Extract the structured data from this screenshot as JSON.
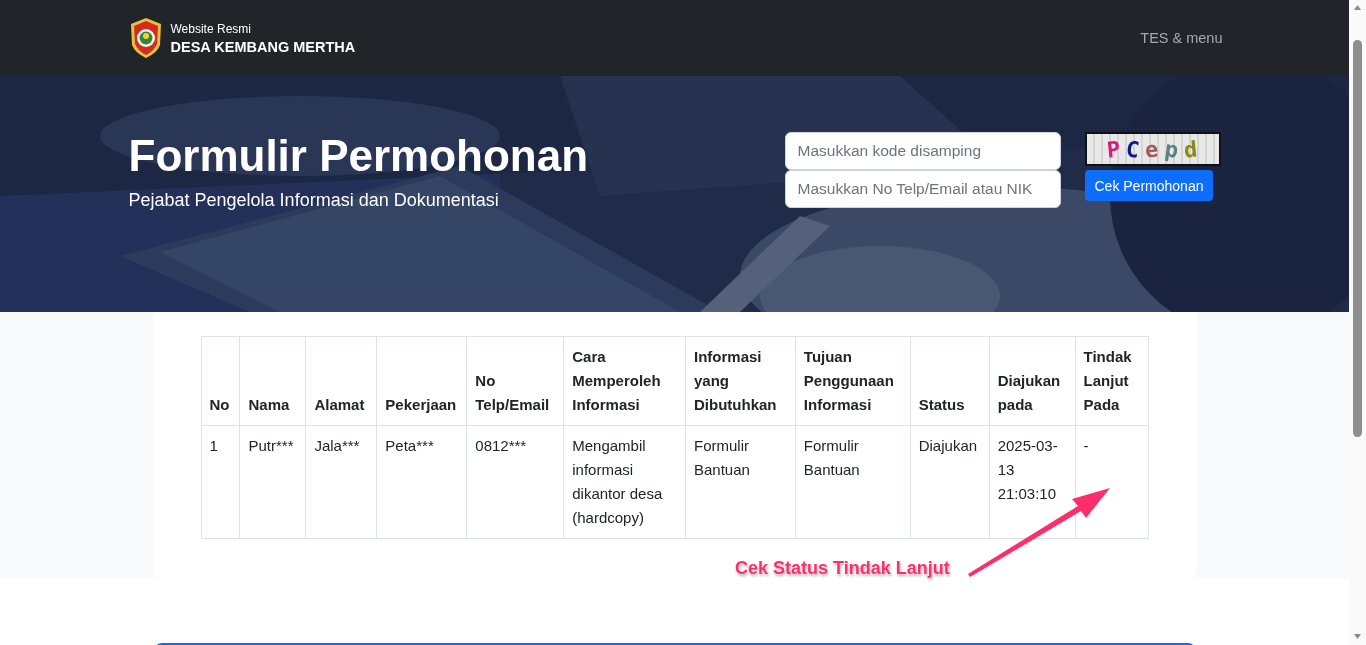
{
  "navbar": {
    "subtitle": "Website Resmi",
    "title": "DESA KEMBANG MERTHA",
    "menu": "TES & menu"
  },
  "hero": {
    "title": "Formulir Permohonan",
    "subtitle": "Pejabat Pengelola Informasi dan Dokumentasi",
    "code_field": {
      "placeholder": "Masukkan kode disamping"
    },
    "id_field": {
      "placeholder": "Masukkan No Telp/Email atau NIK"
    },
    "captcha": "PCepd",
    "button": "Cek Permohonan"
  },
  "table": {
    "columns": [
      "No",
      "Nama",
      "Alamat",
      "Pekerjaan",
      "No Telp/Email",
      "Cara Memperoleh Informasi",
      "Informasi yang Dibutuhkan",
      "Tujuan Penggunaan Informasi",
      "Status",
      "Diajukan pada",
      "Tindak Lanjut Pada"
    ],
    "rows": [
      [
        "1",
        "Putr***",
        "Jala***",
        "Peta***",
        "0812***",
        "Mengambil informasi dikantor desa (hardcopy)",
        "Formulir Bantuan",
        "Formulir Bantuan",
        "Diajukan",
        "2025-03-13 21:03:10",
        "-"
      ]
    ]
  },
  "annotation": {
    "text": "Cek Status Tindak Lanjut",
    "color": "#ff2d6b"
  }
}
